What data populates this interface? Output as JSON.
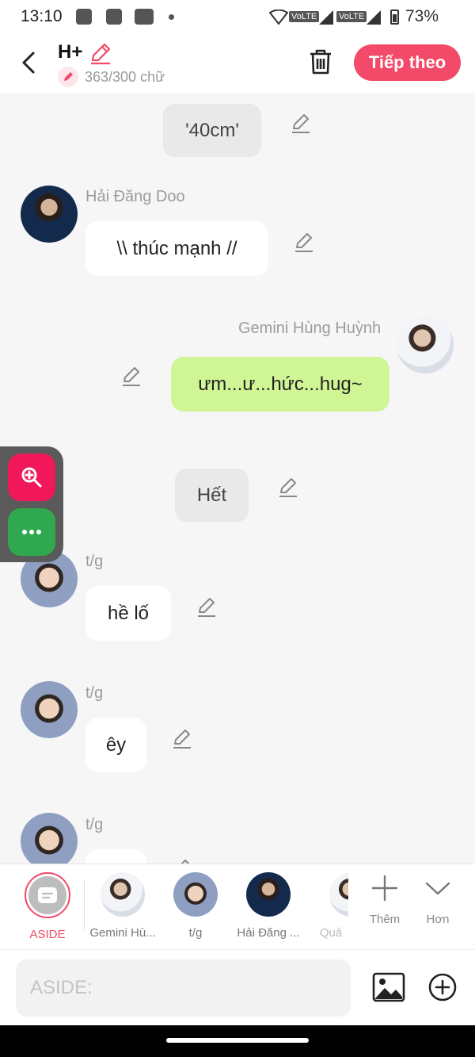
{
  "status_bar": {
    "time": "13:10",
    "volte1": "VoLTE",
    "volte2": "VoLTE",
    "battery": "73%"
  },
  "header": {
    "title": "H+",
    "counter": "363/300 chữ",
    "next_label": "Tiếp theo"
  },
  "messages": {
    "m1": {
      "text": "'40cm'"
    },
    "m2": {
      "sender": "Hải Đăng Doo",
      "text": "\\\\ thúc mạnh //"
    },
    "m3": {
      "sender": "Gemini Hùng Huỳnh",
      "text": "ưm...ư...hức...hug~"
    },
    "m4": {
      "text": "Hết"
    },
    "m5": {
      "sender": "t/g",
      "text": "hề lố"
    },
    "m6": {
      "sender": "t/g",
      "text": "êy"
    },
    "m7": {
      "sender": "t/g"
    }
  },
  "characters": {
    "aside": "ASIDE",
    "c1": "Gemini Hù...",
    "c2": "t/g",
    "c3": "Hải Đăng ...",
    "c4": "Quả",
    "add": "Thêm",
    "more": "Hơn"
  },
  "input": {
    "placeholder": "ASIDE:"
  },
  "colors": {
    "accent": "#f24a68",
    "bubble_right": "#cff595",
    "zoom_button": "#f0185b",
    "more_button": "#2fa84f"
  }
}
